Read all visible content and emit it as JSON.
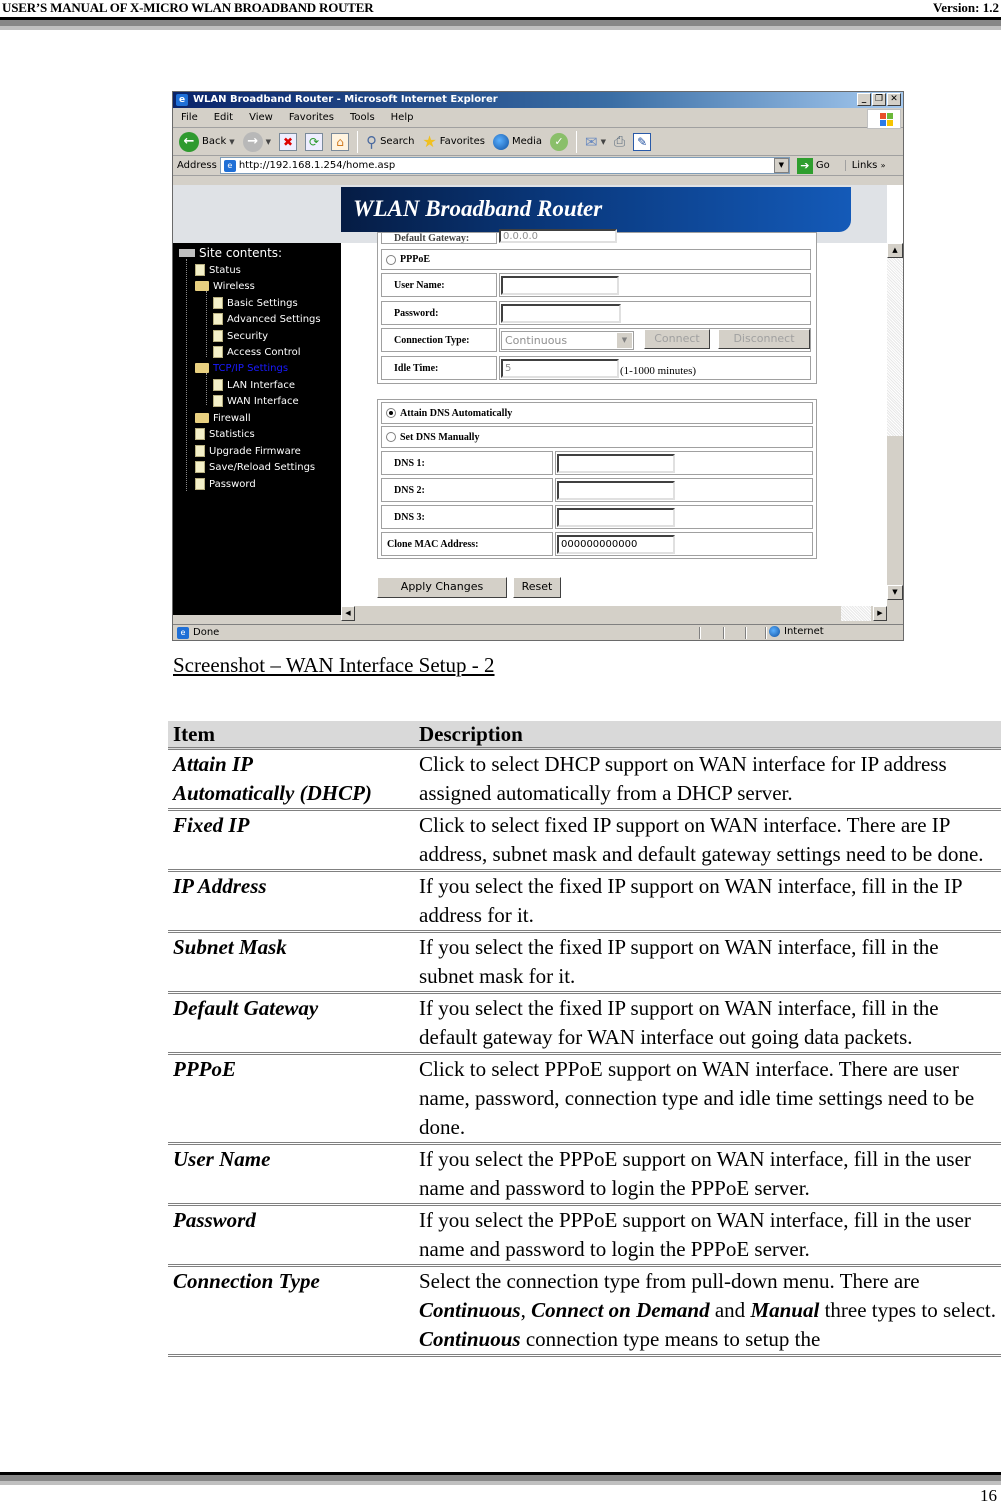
{
  "page_header": {
    "title": "USER’S MANUAL OF X-MICRO WLAN BROADBAND ROUTER",
    "version": "Version: 1.2"
  },
  "page_number": "16",
  "browser": {
    "window_title": "WLAN Broadband Router - Microsoft Internet Explorer",
    "menu": [
      "File",
      "Edit",
      "View",
      "Favorites",
      "Tools",
      "Help"
    ],
    "toolbar": {
      "back": "Back",
      "search": "Search",
      "favorites": "Favorites",
      "media": "Media"
    },
    "address_label": "Address",
    "address_value": "http://192.168.1.254/home.asp",
    "go_label": "Go",
    "links_label": "Links",
    "status_text": "Done",
    "zone_text": "Internet"
  },
  "router_page": {
    "banner": "WLAN Broadband Router",
    "sidebar": {
      "root": "Site contents:",
      "items": [
        {
          "label": "Status",
          "type": "doc",
          "level": 1
        },
        {
          "label": "Wireless",
          "type": "folder-open",
          "level": 1
        },
        {
          "label": "Basic Settings",
          "type": "doc",
          "level": 2
        },
        {
          "label": "Advanced Settings",
          "type": "doc",
          "level": 2
        },
        {
          "label": "Security",
          "type": "doc",
          "level": 2
        },
        {
          "label": "Access Control",
          "type": "doc",
          "level": 2
        },
        {
          "label": "TCP/IP Settings",
          "type": "folder-open",
          "level": 1,
          "active": true
        },
        {
          "label": "LAN Interface",
          "type": "doc",
          "level": 2
        },
        {
          "label": "WAN Interface",
          "type": "doc",
          "level": 2
        },
        {
          "label": "Firewall",
          "type": "folder",
          "level": 1
        },
        {
          "label": "Statistics",
          "type": "doc",
          "level": 1
        },
        {
          "label": "Upgrade Firmware",
          "type": "doc",
          "level": 1
        },
        {
          "label": "Save/Reload Settings",
          "type": "doc",
          "level": 1
        },
        {
          "label": "Password",
          "type": "doc",
          "level": 1
        }
      ]
    },
    "form": {
      "default_gateway_label": "Default Gateway:",
      "default_gateway_value": "0.0.0.0",
      "pppoe_label": "PPPoE",
      "pppoe_selected": false,
      "user_name_label": "User Name:",
      "user_name_value": "",
      "password_label": "Password:",
      "password_value": "",
      "connection_type_label": "Connection Type:",
      "connection_type_value": "Continuous",
      "connect_button": "Connect",
      "disconnect_button": "Disconnect",
      "idle_time_label": "Idle Time:",
      "idle_time_value": "5",
      "idle_time_note": "(1-1000 minutes)",
      "attain_dns_label": "Attain DNS Automatically",
      "attain_dns_selected": true,
      "set_dns_label": "Set DNS Manually",
      "set_dns_selected": false,
      "dns1_label": "DNS 1:",
      "dns1_value": "",
      "dns2_label": "DNS 2:",
      "dns2_value": "",
      "dns3_label": "DNS 3:",
      "dns3_value": "",
      "clone_mac_label": "Clone MAC Address:",
      "clone_mac_value": "000000000000",
      "apply_button": "Apply Changes",
      "reset_button": "Reset"
    }
  },
  "caption": "Screenshot – WAN Interface Setup - 2",
  "table": {
    "headers": [
      "Item",
      "Description"
    ],
    "rows": [
      {
        "item": "Attain IP Automatically (DHCP)",
        "item_lines": [
          "Attain IP",
          "Automatically (DHCP)"
        ],
        "description": "Click to select DHCP support on WAN interface for IP address assigned automatically from a DHCP server."
      },
      {
        "item": "Fixed IP",
        "description": "Click to select fixed IP support on WAN interface. There are IP address, subnet mask and default gateway settings need to be done."
      },
      {
        "item": "IP Address",
        "description": "If you select the fixed IP support on WAN interface, fill in the IP address for it."
      },
      {
        "item": "Subnet Mask",
        "description": "If you select the fixed IP support on WAN interface, fill in the subnet mask for it."
      },
      {
        "item": "Default Gateway",
        "description": "If you select the fixed IP support on WAN interface, fill in the default gateway for WAN interface out going data packets."
      },
      {
        "item": "PPPoE",
        "description": "Click to select PPPoE support on WAN interface. There are user name, password, connection type and idle time settings need to be done."
      },
      {
        "item": "User Name",
        "description": "If you select the PPPoE support on WAN interface, fill in the user name and password to login the PPPoE server."
      },
      {
        "item": "Password",
        "description": "If you select the PPPoE support on WAN interface, fill in the user name and password to login the PPPoE server."
      },
      {
        "item": "Connection Type",
        "description_parts": {
          "p1_a": "Select the connection type from pull-down menu. There are ",
          "opt1": "Continuous",
          "p1_b": ", ",
          "opt2": "Connect on Demand",
          "p1_c": " and ",
          "opt3": "Manual",
          "p1_d": " three types to select.",
          "p2_bold": "Continuous",
          "p2_rest": " connection type means to setup the"
        }
      }
    ]
  }
}
